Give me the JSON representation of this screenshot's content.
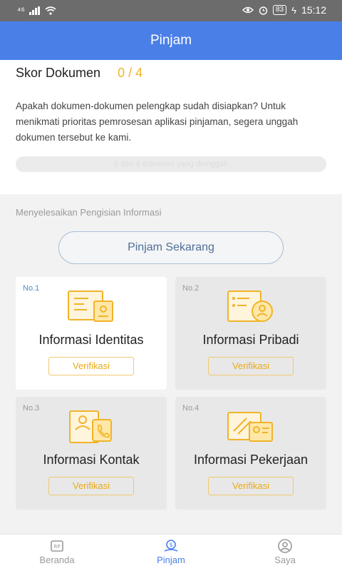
{
  "status_bar": {
    "signal_text": "⁴⁶",
    "battery": "83",
    "time": "15:12"
  },
  "header": {
    "title": "Pinjam"
  },
  "score": {
    "label": "Skor Dokumen",
    "value": "0 / 4"
  },
  "description": "Apakah dokumen-dokumen pelengkap sudah disiapkan? Untuk menikmati prioritas pemrosesan aplikasi pinjaman, segera unggah dokumen tersebut ke kami.",
  "progress": {
    "text": "0 dari 4 dokumen yang diunggah",
    "fraction": 0
  },
  "section": {
    "title": "Menyelesaikan Pengisian Informasi",
    "cta_label": "Pinjam Sekarang"
  },
  "cards": [
    {
      "number": "No.1",
      "title": "Informasi Identitas",
      "button": "Verifikasi",
      "icon": "id-card-icon"
    },
    {
      "number": "No.2",
      "title": "Informasi Pribadi",
      "button": "Verifikasi",
      "icon": "personal-profile-icon"
    },
    {
      "number": "No.3",
      "title": "Informasi Kontak",
      "button": "Verifikasi",
      "icon": "contact-book-icon"
    },
    {
      "number": "No.4",
      "title": "Informasi Pekerjaan",
      "button": "Verifikasi",
      "icon": "work-card-icon"
    }
  ],
  "bottom_nav": [
    {
      "label": "Beranda",
      "icon": "home-rp-icon"
    },
    {
      "label": "Pinjam",
      "icon": "loan-icon",
      "active": true
    },
    {
      "label": "Saya",
      "icon": "profile-icon"
    }
  ],
  "colors": {
    "primary": "#4a7fe8",
    "accent": "#f0b429",
    "card_button": "#e8a91a"
  }
}
